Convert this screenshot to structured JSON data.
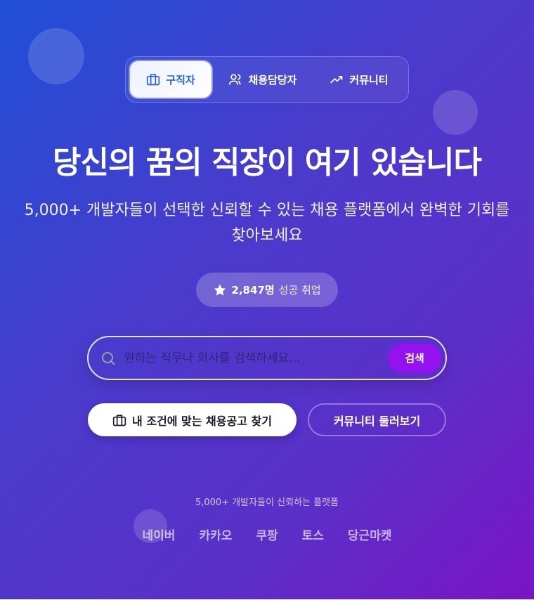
{
  "tabs": [
    {
      "label": "구직자",
      "icon": "briefcase-icon",
      "active": true
    },
    {
      "label": "채용담당자",
      "icon": "users-icon"
    },
    {
      "label": "커뮤니티",
      "icon": "trending-up-icon"
    }
  ],
  "hero": {
    "title": "당신의 꿈의 직장이 여기 있습니다",
    "subtitle": "5,000+ 개발자들이 선택한 신뢰할 수 있는 채용 플랫폼에서 완벽한 기회를 찾아보세요"
  },
  "badge": {
    "icon": "star-icon",
    "count": "2,847명",
    "label": "성공 취업"
  },
  "search": {
    "placeholder": "원하는 직무나 회사를 검색하세요...",
    "value": "",
    "button": "검색"
  },
  "cta": {
    "primary": "내 조건에 맞는 채용공고 찾기",
    "secondary": "커뮤니티 둘러보기"
  },
  "trust": {
    "text": "5,000+ 개발자들이 신뢰하는 플랫폼",
    "companies": [
      "네이버",
      "카카오",
      "쿠팡",
      "토스",
      "당근마켓"
    ]
  },
  "colors": {
    "accent": "#2563eb",
    "search_button": "#9512f0",
    "gradient_start": "#1f4fd6",
    "gradient_end": "#7a14c6"
  }
}
